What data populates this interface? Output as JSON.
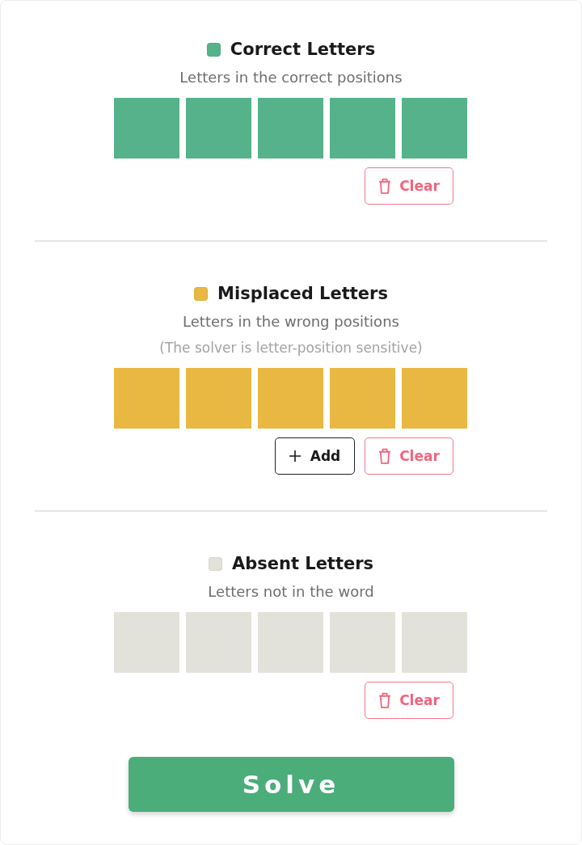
{
  "sections": [
    {
      "title": "Correct Letters",
      "color": "#56b28a",
      "subtitle": "Letters in the correct positions",
      "buttons": [
        {
          "kind": "clear",
          "label": "Clear"
        }
      ]
    },
    {
      "title": "Misplaced Letters",
      "color": "#e8b842",
      "subtitle": "Letters in the wrong positions",
      "note": "(The solver is letter-position sensitive)",
      "buttons": [
        {
          "kind": "add",
          "label": "Add"
        },
        {
          "kind": "clear",
          "label": "Clear"
        }
      ]
    },
    {
      "title": "Absent Letters",
      "color": "#e2e2da",
      "subtitle": "Letters not in the word",
      "buttons": [
        {
          "kind": "clear",
          "label": "Clear"
        }
      ]
    }
  ],
  "solve_button": {
    "label": "Solve"
  }
}
